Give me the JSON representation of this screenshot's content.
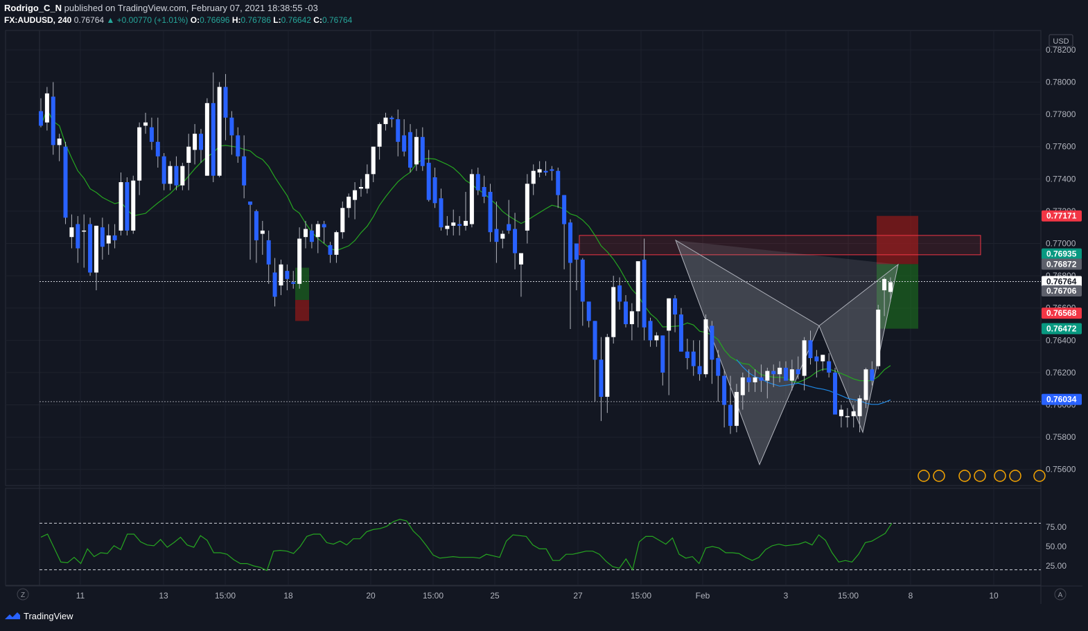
{
  "header": {
    "author": "Rodrigo_C_N",
    "published_text": " published on TradingView.com, February 07, 2021 18:38:55 -03",
    "symbol": "FX:AUDUSD, 240",
    "last": "0.76764",
    "change": "▲ +0.00770 (+1.01%)",
    "o_label": "O:",
    "o_value": "0.76696",
    "h_label": "H:",
    "h_value": "0.76786",
    "l_label": "L:",
    "l_value": "0.76642",
    "c_label": "C:",
    "c_value": "0.76764"
  },
  "footer": {
    "brand": "TradingView"
  },
  "colors": {
    "background": "#131722",
    "up_candle": "#ffffff",
    "down_candle": "#2962ff",
    "ma_green": "#26a621",
    "ma_blue": "#1e88e5",
    "rsi_line": "#26a621",
    "supply_zone": "#f23645",
    "target_green": "#1e7a1e",
    "stop_red": "#8b1a1a"
  },
  "chart_data": [
    {
      "type": "candlestick",
      "title": "",
      "currency_label": "USD",
      "ylim": [
        0.755,
        0.7832
      ],
      "y_ticks": [
        "0.78200",
        "0.78000",
        "0.77800",
        "0.77600",
        "0.77400",
        "0.77200",
        "0.77000",
        "0.76800",
        "0.76600",
        "0.76400",
        "0.76200",
        "0.76000",
        "0.75800",
        "0.75600"
      ],
      "x_tick_labels": [
        "11",
        "13",
        "15:00",
        "18",
        "20",
        "15:00",
        "25",
        "27",
        "15:00",
        "Feb",
        "3",
        "15:00",
        "8",
        "10"
      ],
      "price_labels": [
        {
          "value": "0.77171",
          "kind": "red"
        },
        {
          "value": "0.76935",
          "kind": "green"
        },
        {
          "value": "0.76872",
          "kind": "gray"
        },
        {
          "value": "0.76764",
          "kind": "white"
        },
        {
          "value": "0.76706",
          "kind": "gray"
        },
        {
          "value": "0.76568",
          "kind": "red"
        },
        {
          "value": "0.76472",
          "kind": "green"
        },
        {
          "value": "0.76034",
          "kind": "blue"
        }
      ],
      "last_price": 0.76764,
      "horizontal_levels": [
        0.76764,
        0.7602
      ],
      "supply_zone": [
        0.7693,
        0.7705
      ],
      "position_stop": [
        0.76872,
        0.77171
      ],
      "position_target": [
        0.76472,
        0.76872
      ],
      "candles": [
        {
          "o": 0.7782,
          "h": 0.779,
          "l": 0.7772,
          "c": 0.7773
        },
        {
          "o": 0.7775,
          "h": 0.7797,
          "l": 0.777,
          "c": 0.7793
        },
        {
          "o": 0.7791,
          "h": 0.78,
          "l": 0.7755,
          "c": 0.7761
        },
        {
          "o": 0.7761,
          "h": 0.7768,
          "l": 0.7751,
          "c": 0.7765
        },
        {
          "o": 0.776,
          "h": 0.7763,
          "l": 0.7712,
          "c": 0.7716
        },
        {
          "o": 0.7704,
          "h": 0.7718,
          "l": 0.7697,
          "c": 0.771
        },
        {
          "o": 0.7712,
          "h": 0.7717,
          "l": 0.7688,
          "c": 0.7697
        },
        {
          "o": 0.7708,
          "h": 0.7718,
          "l": 0.7685,
          "c": 0.7708
        },
        {
          "o": 0.7712,
          "h": 0.7716,
          "l": 0.768,
          "c": 0.7682
        },
        {
          "o": 0.7682,
          "h": 0.77,
          "l": 0.7671,
          "c": 0.7711
        },
        {
          "o": 0.771,
          "h": 0.7716,
          "l": 0.769,
          "c": 0.7698
        },
        {
          "o": 0.77,
          "h": 0.7712,
          "l": 0.7693,
          "c": 0.7705
        },
        {
          "o": 0.7705,
          "h": 0.7712,
          "l": 0.7697,
          "c": 0.7702
        },
        {
          "o": 0.7708,
          "h": 0.7744,
          "l": 0.7705,
          "c": 0.7738
        },
        {
          "o": 0.7738,
          "h": 0.7741,
          "l": 0.7705,
          "c": 0.7708
        },
        {
          "o": 0.7708,
          "h": 0.7742,
          "l": 0.7706,
          "c": 0.7739
        },
        {
          "o": 0.7739,
          "h": 0.7775,
          "l": 0.773,
          "c": 0.7772
        },
        {
          "o": 0.7773,
          "h": 0.7781,
          "l": 0.7768,
          "c": 0.7775
        },
        {
          "o": 0.7772,
          "h": 0.7778,
          "l": 0.7758,
          "c": 0.7763
        },
        {
          "o": 0.7763,
          "h": 0.7778,
          "l": 0.7747,
          "c": 0.7754
        },
        {
          "o": 0.7754,
          "h": 0.7756,
          "l": 0.7733,
          "c": 0.7737
        },
        {
          "o": 0.7737,
          "h": 0.7751,
          "l": 0.7733,
          "c": 0.7748
        },
        {
          "o": 0.7748,
          "h": 0.7754,
          "l": 0.7733,
          "c": 0.7736
        },
        {
          "o": 0.7736,
          "h": 0.775,
          "l": 0.7733,
          "c": 0.7748
        },
        {
          "o": 0.775,
          "h": 0.7768,
          "l": 0.7733,
          "c": 0.776
        },
        {
          "o": 0.7758,
          "h": 0.7774,
          "l": 0.7749,
          "c": 0.7768
        },
        {
          "o": 0.7768,
          "h": 0.7771,
          "l": 0.775,
          "c": 0.7758
        },
        {
          "o": 0.7742,
          "h": 0.779,
          "l": 0.7742,
          "c": 0.7787
        },
        {
          "o": 0.7787,
          "h": 0.7806,
          "l": 0.7738,
          "c": 0.7742
        },
        {
          "o": 0.7742,
          "h": 0.78,
          "l": 0.7741,
          "c": 0.7797
        },
        {
          "o": 0.7797,
          "h": 0.7805,
          "l": 0.7764,
          "c": 0.7778
        },
        {
          "o": 0.7778,
          "h": 0.7782,
          "l": 0.7755,
          "c": 0.7767
        },
        {
          "o": 0.7767,
          "h": 0.7772,
          "l": 0.775,
          "c": 0.7754
        },
        {
          "o": 0.7754,
          "h": 0.7767,
          "l": 0.7728,
          "c": 0.7736
        },
        {
          "o": 0.7726,
          "h": 0.7726,
          "l": 0.769,
          "c": 0.7724
        },
        {
          "o": 0.772,
          "h": 0.7721,
          "l": 0.7688,
          "c": 0.7702
        },
        {
          "o": 0.7706,
          "h": 0.7714,
          "l": 0.7693,
          "c": 0.7708
        },
        {
          "o": 0.7702,
          "h": 0.7708,
          "l": 0.7675,
          "c": 0.7687
        },
        {
          "o": 0.7682,
          "h": 0.7691,
          "l": 0.7661,
          "c": 0.7667
        },
        {
          "o": 0.7674,
          "h": 0.769,
          "l": 0.7668,
          "c": 0.7687
        },
        {
          "o": 0.7683,
          "h": 0.7687,
          "l": 0.7671,
          "c": 0.7678
        },
        {
          "o": 0.7676,
          "h": 0.7683,
          "l": 0.7672,
          "c": 0.7675
        },
        {
          "o": 0.7675,
          "h": 0.771,
          "l": 0.7672,
          "c": 0.7703
        },
        {
          "o": 0.7704,
          "h": 0.7714,
          "l": 0.7697,
          "c": 0.7709
        },
        {
          "o": 0.7708,
          "h": 0.7712,
          "l": 0.7697,
          "c": 0.7701
        },
        {
          "o": 0.7704,
          "h": 0.7714,
          "l": 0.7694,
          "c": 0.7712
        },
        {
          "o": 0.7712,
          "h": 0.7714,
          "l": 0.77,
          "c": 0.771
        },
        {
          "o": 0.7699,
          "h": 0.7701,
          "l": 0.7688,
          "c": 0.7693
        },
        {
          "o": 0.7693,
          "h": 0.7708,
          "l": 0.7688,
          "c": 0.7707
        },
        {
          "o": 0.7707,
          "h": 0.7726,
          "l": 0.7703,
          "c": 0.7722
        },
        {
          "o": 0.7722,
          "h": 0.7731,
          "l": 0.7716,
          "c": 0.7729
        },
        {
          "o": 0.7727,
          "h": 0.7738,
          "l": 0.7715,
          "c": 0.7733
        },
        {
          "o": 0.7734,
          "h": 0.774,
          "l": 0.7729,
          "c": 0.7735
        },
        {
          "o": 0.7734,
          "h": 0.7749,
          "l": 0.7731,
          "c": 0.7743
        },
        {
          "o": 0.7743,
          "h": 0.7759,
          "l": 0.7738,
          "c": 0.776
        },
        {
          "o": 0.776,
          "h": 0.7775,
          "l": 0.7752,
          "c": 0.7774
        },
        {
          "o": 0.7774,
          "h": 0.7781,
          "l": 0.777,
          "c": 0.7778
        },
        {
          "o": 0.7778,
          "h": 0.7779,
          "l": 0.7772,
          "c": 0.7777
        },
        {
          "o": 0.7777,
          "h": 0.7783,
          "l": 0.7754,
          "c": 0.7763
        },
        {
          "o": 0.7767,
          "h": 0.7777,
          "l": 0.7754,
          "c": 0.7757
        },
        {
          "o": 0.7769,
          "h": 0.7774,
          "l": 0.7744,
          "c": 0.7747
        },
        {
          "o": 0.7749,
          "h": 0.7771,
          "l": 0.7745,
          "c": 0.7766
        },
        {
          "o": 0.7766,
          "h": 0.7772,
          "l": 0.7745,
          "c": 0.7748
        },
        {
          "o": 0.775,
          "h": 0.7758,
          "l": 0.7726,
          "c": 0.7727
        },
        {
          "o": 0.7741,
          "h": 0.7747,
          "l": 0.7722,
          "c": 0.7725
        },
        {
          "o": 0.7728,
          "h": 0.7734,
          "l": 0.7708,
          "c": 0.771
        },
        {
          "o": 0.7709,
          "h": 0.7717,
          "l": 0.7705,
          "c": 0.7711
        },
        {
          "o": 0.7711,
          "h": 0.7721,
          "l": 0.7705,
          "c": 0.7713
        },
        {
          "o": 0.7712,
          "h": 0.7717,
          "l": 0.7705,
          "c": 0.7711
        },
        {
          "o": 0.7711,
          "h": 0.7732,
          "l": 0.7708,
          "c": 0.7714
        },
        {
          "o": 0.7712,
          "h": 0.7746,
          "l": 0.771,
          "c": 0.7743
        },
        {
          "o": 0.7743,
          "h": 0.7747,
          "l": 0.773,
          "c": 0.7733
        },
        {
          "o": 0.7735,
          "h": 0.7742,
          "l": 0.7725,
          "c": 0.7729
        },
        {
          "o": 0.7732,
          "h": 0.7737,
          "l": 0.7701,
          "c": 0.7707
        },
        {
          "o": 0.7709,
          "h": 0.7726,
          "l": 0.7688,
          "c": 0.7701
        },
        {
          "o": 0.7703,
          "h": 0.7708,
          "l": 0.7697,
          "c": 0.7706
        },
        {
          "o": 0.7712,
          "h": 0.7727,
          "l": 0.7706,
          "c": 0.7708
        },
        {
          "o": 0.7709,
          "h": 0.7719,
          "l": 0.7684,
          "c": 0.7694
        },
        {
          "o": 0.7687,
          "h": 0.7685,
          "l": 0.7667,
          "c": 0.7694
        },
        {
          "o": 0.7708,
          "h": 0.7743,
          "l": 0.77,
          "c": 0.7737
        },
        {
          "o": 0.7737,
          "h": 0.7749,
          "l": 0.773,
          "c": 0.7745
        },
        {
          "o": 0.7744,
          "h": 0.7751,
          "l": 0.7741,
          "c": 0.7746
        },
        {
          "o": 0.7745,
          "h": 0.7751,
          "l": 0.7742,
          "c": 0.7744
        },
        {
          "o": 0.7746,
          "h": 0.7748,
          "l": 0.7739,
          "c": 0.7745
        },
        {
          "o": 0.7745,
          "h": 0.7747,
          "l": 0.7722,
          "c": 0.773
        },
        {
          "o": 0.773,
          "h": 0.773,
          "l": 0.7684,
          "c": 0.7712
        },
        {
          "o": 0.7713,
          "h": 0.7715,
          "l": 0.7647,
          "c": 0.7688
        },
        {
          "o": 0.77,
          "h": 0.77,
          "l": 0.7671,
          "c": 0.769
        },
        {
          "o": 0.769,
          "h": 0.7691,
          "l": 0.7649,
          "c": 0.7664
        },
        {
          "o": 0.7664,
          "h": 0.766,
          "l": 0.7648,
          "c": 0.7652
        },
        {
          "o": 0.7652,
          "h": 0.765,
          "l": 0.7602,
          "c": 0.7628
        },
        {
          "o": 0.7628,
          "h": 0.7642,
          "l": 0.759,
          "c": 0.7605
        },
        {
          "o": 0.7605,
          "h": 0.7644,
          "l": 0.7595,
          "c": 0.7642
        },
        {
          "o": 0.7642,
          "h": 0.768,
          "l": 0.7638,
          "c": 0.7673
        },
        {
          "o": 0.7674,
          "h": 0.7679,
          "l": 0.7659,
          "c": 0.7664
        },
        {
          "o": 0.7664,
          "h": 0.7668,
          "l": 0.7648,
          "c": 0.765
        },
        {
          "o": 0.765,
          "h": 0.7663,
          "l": 0.764,
          "c": 0.7658
        },
        {
          "o": 0.7658,
          "h": 0.7688,
          "l": 0.7648,
          "c": 0.7689
        },
        {
          "o": 0.769,
          "h": 0.7703,
          "l": 0.764,
          "c": 0.7648
        },
        {
          "o": 0.7652,
          "h": 0.7654,
          "l": 0.7636,
          "c": 0.764
        },
        {
          "o": 0.764,
          "h": 0.7645,
          "l": 0.7636,
          "c": 0.7643
        },
        {
          "o": 0.7643,
          "h": 0.764,
          "l": 0.7612,
          "c": 0.762
        },
        {
          "o": 0.7646,
          "h": 0.7666,
          "l": 0.7606,
          "c": 0.7666
        },
        {
          "o": 0.7666,
          "h": 0.7668,
          "l": 0.7645,
          "c": 0.7656
        },
        {
          "o": 0.7656,
          "h": 0.766,
          "l": 0.7633,
          "c": 0.7633
        },
        {
          "o": 0.7633,
          "h": 0.7641,
          "l": 0.7622,
          "c": 0.7629
        },
        {
          "o": 0.7633,
          "h": 0.764,
          "l": 0.7618,
          "c": 0.7624
        },
        {
          "o": 0.7624,
          "h": 0.764,
          "l": 0.7615,
          "c": 0.7619
        },
        {
          "o": 0.7619,
          "h": 0.7656,
          "l": 0.7617,
          "c": 0.7653
        },
        {
          "o": 0.7649,
          "h": 0.7652,
          "l": 0.7613,
          "c": 0.7628
        },
        {
          "o": 0.7629,
          "h": 0.7634,
          "l": 0.7602,
          "c": 0.7618
        },
        {
          "o": 0.7618,
          "h": 0.7622,
          "l": 0.7586,
          "c": 0.76
        },
        {
          "o": 0.76,
          "h": 0.7618,
          "l": 0.7582,
          "c": 0.7587
        },
        {
          "o": 0.7587,
          "h": 0.7613,
          "l": 0.7583,
          "c": 0.7608
        },
        {
          "o": 0.7606,
          "h": 0.762,
          "l": 0.7597,
          "c": 0.7617
        },
        {
          "o": 0.7617,
          "h": 0.7622,
          "l": 0.7608,
          "c": 0.7614
        },
        {
          "o": 0.7614,
          "h": 0.7622,
          "l": 0.7608,
          "c": 0.7617
        },
        {
          "o": 0.7617,
          "h": 0.7625,
          "l": 0.7608,
          "c": 0.7615
        },
        {
          "o": 0.7615,
          "h": 0.7623,
          "l": 0.7604,
          "c": 0.7621
        },
        {
          "o": 0.7621,
          "h": 0.7625,
          "l": 0.7611,
          "c": 0.7619
        },
        {
          "o": 0.7619,
          "h": 0.7627,
          "l": 0.7614,
          "c": 0.7623
        },
        {
          "o": 0.7623,
          "h": 0.7627,
          "l": 0.7616,
          "c": 0.7615
        },
        {
          "o": 0.7615,
          "h": 0.7628,
          "l": 0.7609,
          "c": 0.7622
        },
        {
          "o": 0.7622,
          "h": 0.763,
          "l": 0.7616,
          "c": 0.7619
        },
        {
          "o": 0.7618,
          "h": 0.7642,
          "l": 0.7609,
          "c": 0.764
        },
        {
          "o": 0.764,
          "h": 0.7646,
          "l": 0.7625,
          "c": 0.7629
        },
        {
          "o": 0.763,
          "h": 0.7634,
          "l": 0.7617,
          "c": 0.7627
        },
        {
          "o": 0.7627,
          "h": 0.7631,
          "l": 0.7621,
          "c": 0.7631
        },
        {
          "o": 0.7627,
          "h": 0.7632,
          "l": 0.7617,
          "c": 0.762
        },
        {
          "o": 0.762,
          "h": 0.7623,
          "l": 0.7596,
          "c": 0.7594
        },
        {
          "o": 0.7593,
          "h": 0.76,
          "l": 0.7586,
          "c": 0.7597
        },
        {
          "o": 0.7593,
          "h": 0.7598,
          "l": 0.7586,
          "c": 0.7593
        },
        {
          "o": 0.7593,
          "h": 0.76,
          "l": 0.7586,
          "c": 0.7596
        },
        {
          "o": 0.7593,
          "h": 0.7606,
          "l": 0.7583,
          "c": 0.7604
        },
        {
          "o": 0.7603,
          "h": 0.7623,
          "l": 0.7598,
          "c": 0.7622
        },
        {
          "o": 0.7622,
          "h": 0.7627,
          "l": 0.7612,
          "c": 0.7615
        },
        {
          "o": 0.7624,
          "h": 0.7662,
          "l": 0.7622,
          "c": 0.7659
        },
        {
          "o": 0.7671,
          "h": 0.7679,
          "l": 0.7655,
          "c": 0.7678
        },
        {
          "o": 0.767,
          "h": 0.7679,
          "l": 0.7664,
          "c": 0.7676
        }
      ],
      "rsi": {
        "ylim": [
          0,
          100
        ],
        "ticks": [
          "75.00",
          "50.00",
          "25.00"
        ],
        "upper": 80,
        "lower": 20,
        "values": [
          62,
          66,
          48,
          30,
          29,
          36,
          28,
          47,
          37,
          42,
          41,
          51,
          46,
          66,
          66,
          56,
          52,
          51,
          59,
          49,
          55,
          62,
          52,
          49,
          64,
          58,
          42,
          42,
          40,
          33,
          28,
          28,
          25,
          23,
          19,
          44,
          45,
          44,
          41,
          50,
          63,
          66,
          66,
          55,
          53,
          57,
          52,
          60,
          60,
          69,
          72,
          73,
          76,
          82,
          85,
          83,
          70,
          62,
          51,
          39,
          35,
          36,
          37,
          36,
          36,
          36,
          35,
          40,
          38,
          36,
          57,
          65,
          64,
          63,
          52,
          47,
          47,
          32,
          32,
          40,
          40,
          42,
          44,
          44,
          40,
          31,
          24,
          22,
          34,
          20,
          56,
          63,
          63,
          58,
          53,
          61,
          40,
          35,
          37,
          28,
          48,
          50,
          48,
          42,
          42,
          41,
          36,
          32,
          36,
          46,
          51,
          53,
          51,
          52,
          53,
          56,
          52,
          65,
          58,
          42,
          30,
          32,
          30,
          40,
          55,
          57,
          62,
          67,
          80
        ]
      }
    }
  ]
}
